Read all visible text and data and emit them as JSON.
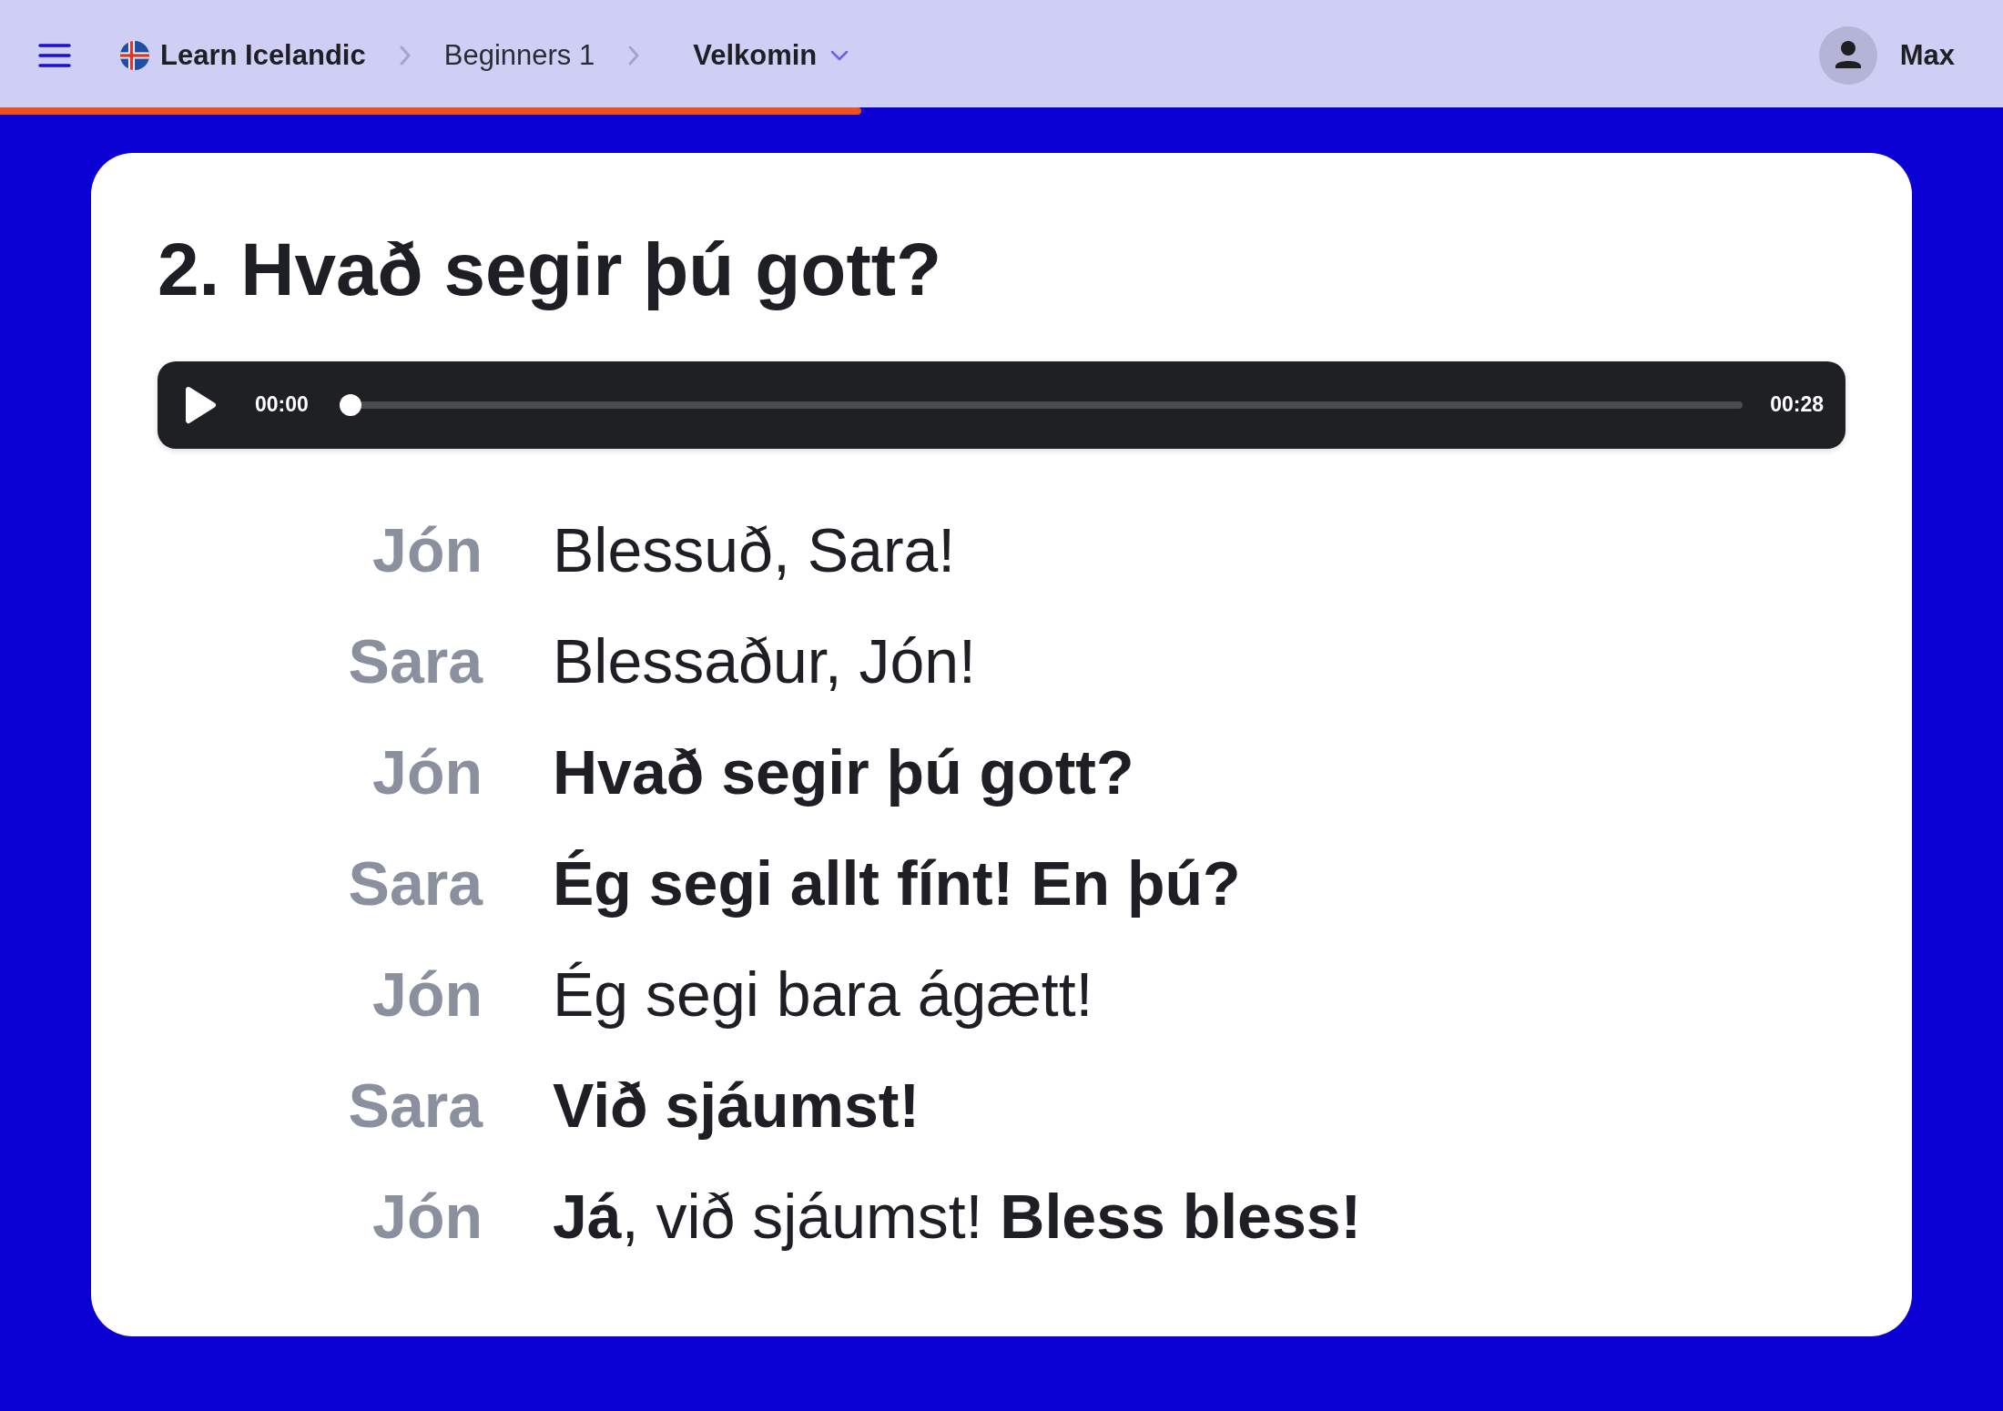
{
  "navbar": {
    "breadcrumbs": [
      {
        "label": "Learn Icelandic",
        "kind": "home"
      },
      {
        "label": "Beginners 1",
        "kind": "link"
      },
      {
        "label": "Velkomin",
        "kind": "dropdown"
      }
    ],
    "user": {
      "name": "Max"
    }
  },
  "progress": {
    "level": 0.43
  },
  "lesson": {
    "title": "2. Hvað segir þú gott?",
    "player": {
      "playing": false,
      "elapsed": "00:00",
      "level": 0,
      "duration": "00:28"
    },
    "dialogue": [
      {
        "speaker": "Jón",
        "text": "Blessuð, Sara!",
        "bold": false
      },
      {
        "speaker": "Sara",
        "text": "Blessaður, Jón!",
        "bold": false
      },
      {
        "speaker": "Jón",
        "text": "Hvað segir þú gott?",
        "bold": true
      },
      {
        "speaker": "Sara",
        "text": "Ég segi allt fínt! En þú?",
        "bold": true
      },
      {
        "speaker": "Jón",
        "text": "Ég segi bara ágætt!",
        "bold": false
      },
      {
        "speaker": "Sara",
        "text": "Við sjáumst!",
        "bold": true
      },
      {
        "speaker": "Jón",
        "text": "**Já**, við sjáumst! **Bless bless!**",
        "bold": false
      }
    ]
  }
}
